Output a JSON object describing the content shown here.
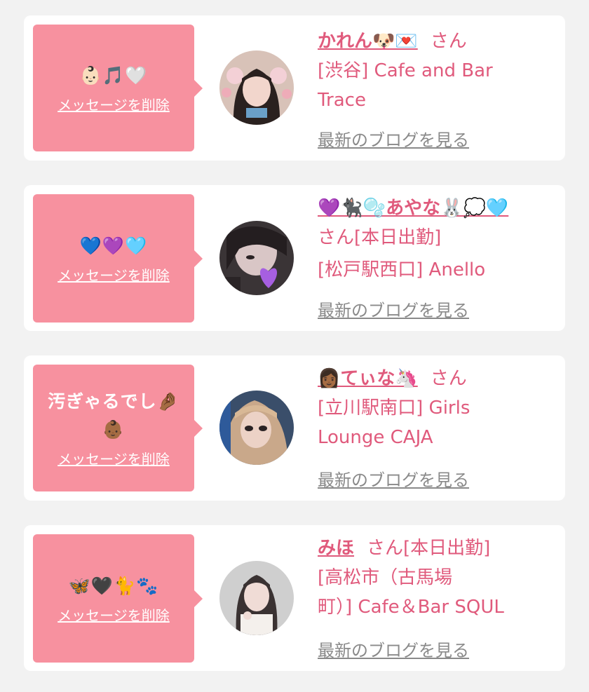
{
  "cards": [
    {
      "message": "👶🏻🎵🤍",
      "delete_label": "メッセージを削除",
      "name": "かれん🐶💌",
      "san": "さん",
      "line2": "[渋谷] Cafe and Bar",
      "line3": "Trace",
      "blog_label": "最新のブログを見る",
      "avatar": "avatar-karen"
    },
    {
      "message": "💙💜🩵",
      "delete_label": "メッセージを削除",
      "name": "💜🐈‍⬛🫧あやな🐰💭🩵",
      "san": "さん[本日出勤]",
      "line2": "[松戸駅西口] Anello",
      "blog_label": "最新のブログを見る",
      "avatar": "avatar-ayana"
    },
    {
      "message": "汚ぎゃるでし🤌🏾",
      "message2": "👶🏾",
      "delete_label": "メッセージを削除",
      "name": "👩🏾てぃな🦄",
      "san": "さん",
      "line2": "[立川駅南口] Girls",
      "line3": "Lounge CAJA",
      "blog_label": "最新のブログを見る",
      "avatar": "avatar-tina"
    },
    {
      "message": "🦋🖤🐈🐾",
      "delete_label": "メッセージを削除",
      "name": "みほ",
      "san": "さん[本日出勤]",
      "line2": "[高松市（古馬場",
      "line3": "町）] Cafe＆Bar SQUL",
      "blog_label": "最新のブログを見る",
      "avatar": "avatar-miho"
    }
  ]
}
